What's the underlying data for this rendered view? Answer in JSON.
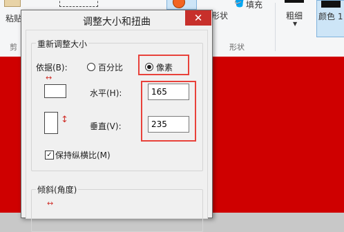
{
  "ribbon": {
    "paste_label": "粘贴",
    "clipboard_label": "剪",
    "shapes_label": "形状",
    "fill_label": "填充",
    "shapes_group_label": "形状",
    "size_label": "粗细",
    "color1_label": "颜色 1"
  },
  "dialog": {
    "title": "调整大小和扭曲",
    "close_glyph": "✕",
    "resize": {
      "group_title": "重新调整大小",
      "by_label": "依据(B):",
      "percent_label": "百分比",
      "pixels_label": "像素",
      "selected": "pixels",
      "horizontal_label": "水平(H):",
      "horizontal_value": "165",
      "vertical_label": "垂直(V):",
      "vertical_value": "235",
      "keep_ratio_label": "保持纵横比(M)",
      "keep_ratio_checked": true
    },
    "skew": {
      "group_title": "倾斜(角度)"
    }
  },
  "colors": {
    "canvas": "#cf0000",
    "highlight": "#e8413a",
    "close": "#c7302b"
  }
}
